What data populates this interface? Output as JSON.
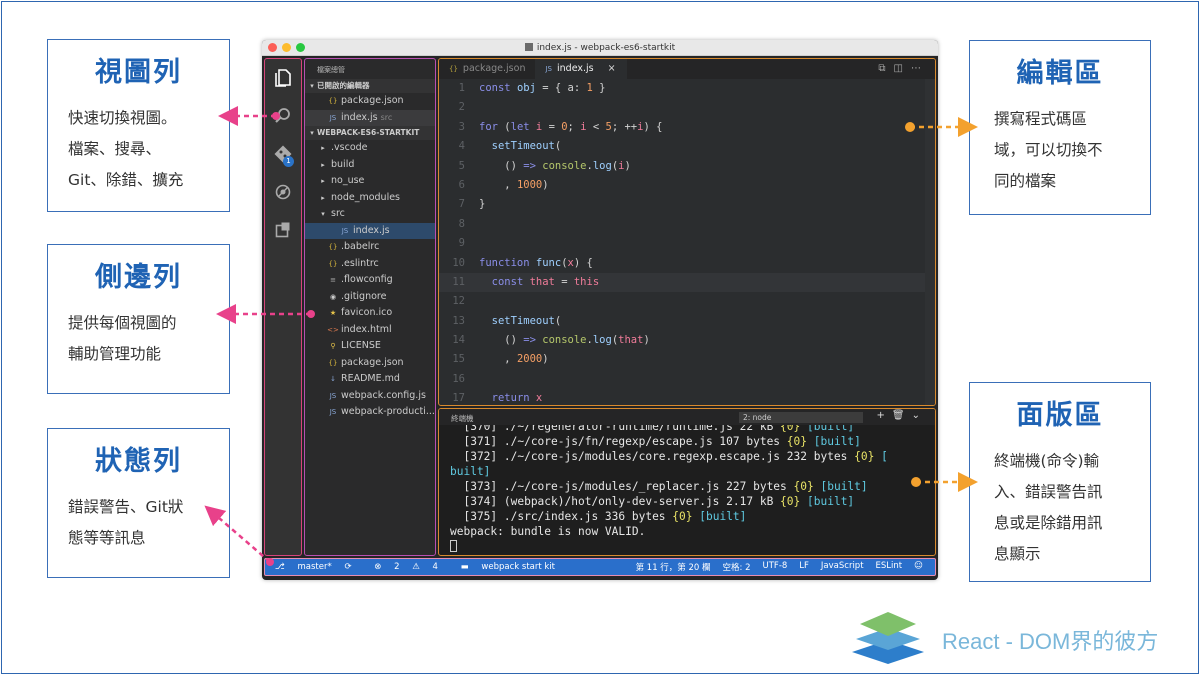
{
  "callouts": {
    "activity": {
      "title": "視圖列",
      "body": "快速切換視圖。\n檔案、搜尋、\nGit、除錯、擴充"
    },
    "sidebar": {
      "title": "側邊列",
      "body": "提供每個視圖的\n輔助管理功能"
    },
    "status": {
      "title": "狀態列",
      "body": "錯誤警告、Git狀\n態等等訊息"
    },
    "editor": {
      "title": "編輯區",
      "body": "撰寫程式碼區\n域，可以切換不\n同的檔案"
    },
    "panel": {
      "title": "面版區",
      "body": "終端機(命令)輸\n入、錯誤警告訊\n息或是除錯用訊\n息顯示"
    }
  },
  "window": {
    "title": "index.js - webpack-es6-startkit"
  },
  "activity_bar": {
    "icons": [
      "files-icon",
      "search-icon",
      "git-icon",
      "debug-icon",
      "extensions-icon"
    ],
    "git_badge": "1"
  },
  "sidebar": {
    "header": "檔案總管",
    "open_editors_label": "已開啟的編輯器",
    "open_editors": [
      {
        "icon": "{}",
        "name": "package.json",
        "suffix": ""
      },
      {
        "icon": "JS",
        "name": "index.js",
        "suffix": "src"
      }
    ],
    "project_label": "WEBPACK-ES6-STARTKIT",
    "tree": [
      {
        "icon": "▸",
        "name": ".vscode"
      },
      {
        "icon": "▸",
        "name": "build"
      },
      {
        "icon": "▸",
        "name": "no_use"
      },
      {
        "icon": "▸",
        "name": "node_modules"
      },
      {
        "icon": "▾",
        "name": "src"
      },
      {
        "icon": "JS",
        "name": "index.js"
      },
      {
        "icon": "{}",
        "name": ".babelrc"
      },
      {
        "icon": "{}",
        "name": ".eslintrc"
      },
      {
        "icon": "≡",
        "name": ".flowconfig"
      },
      {
        "icon": "◉",
        "name": ".gitignore"
      },
      {
        "icon": "★",
        "name": "favicon.ico"
      },
      {
        "icon": "<>",
        "name": "index.html"
      },
      {
        "icon": "⚲",
        "name": "LICENSE"
      },
      {
        "icon": "{}",
        "name": "package.json"
      },
      {
        "icon": "↓",
        "name": "README.md"
      },
      {
        "icon": "JS",
        "name": "webpack.config.js"
      },
      {
        "icon": "JS",
        "name": "webpack-producti..."
      }
    ]
  },
  "editor": {
    "tabs": [
      {
        "icon": "{}",
        "label": "package.json"
      },
      {
        "icon": "JS",
        "label": "index.js"
      }
    ],
    "tab_close": "×",
    "line_numbers": [
      "1",
      "2",
      "3",
      "4",
      "5",
      "6",
      "7",
      "8",
      "9",
      "10",
      "11",
      "12",
      "13",
      "14",
      "15",
      "16",
      "17",
      "18"
    ]
  },
  "panel": {
    "title": "終端機",
    "terminal_select": "2: node",
    "lines": [
      "  [370] ./~/regenerator-runtime/runtime.js 22 kB {0} [built]",
      "  [371] ./~/core-js/fn/regexp/escape.js 107 bytes {0} [built]",
      "  [372] ./~/core-js/modules/core.regexp.escape.js 232 bytes {0} [",
      "built]",
      "  [373] ./~/core-js/modules/_replacer.js 227 bytes {0} [built]",
      "  [374] (webpack)/hot/only-dev-server.js 2.17 kB {0} [built]",
      "  [375] ./src/index.js 336 bytes {0} [built]",
      "webpack: bundle is now VALID."
    ]
  },
  "statusbar": {
    "branch": "master*",
    "errors": "2",
    "warnings": "4",
    "folder": "webpack start kit",
    "position": "第 11 行，第 20 欄",
    "spaces": "空格: 2",
    "encoding": "UTF-8",
    "eol": "LF",
    "language": "JavaScript",
    "linter": "ESLint"
  },
  "brand": {
    "text": "React - DOM界的彼方"
  },
  "colors": {
    "callout_title": "#1f63b4",
    "activity_border": "#d6447a",
    "sidebar_border": "#b94fb0",
    "editor_border": "#d88a2e",
    "statusbar": "#2a6fcb"
  }
}
